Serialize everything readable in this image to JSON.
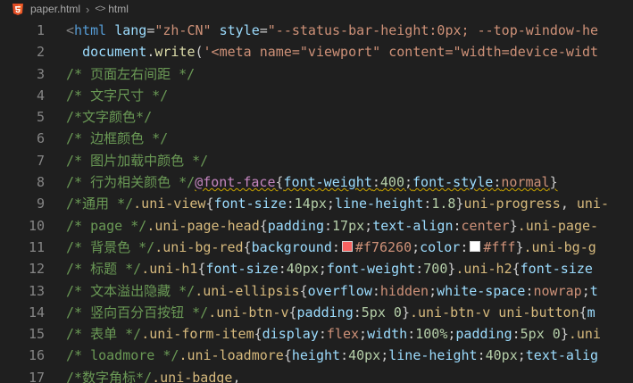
{
  "breadcrumb": {
    "file": "paper.html",
    "symbol": "html"
  },
  "colors": {
    "swatch_red": "#f76260",
    "swatch_white": "#ffffff"
  },
  "lines": [
    {
      "n": "1",
      "tokens": [
        {
          "c": "tag",
          "t": "<"
        },
        {
          "c": "tn",
          "t": "html"
        },
        {
          "c": "pl",
          "t": " "
        },
        {
          "c": "at",
          "t": "lang"
        },
        {
          "c": "pl",
          "t": "="
        },
        {
          "c": "st",
          "t": "\"zh-CN\""
        },
        {
          "c": "pl",
          "t": " "
        },
        {
          "c": "at",
          "t": "style"
        },
        {
          "c": "pl",
          "t": "="
        },
        {
          "c": "st",
          "t": "\"--status-bar-height:0px; --top-window-he"
        }
      ]
    },
    {
      "n": "2",
      "tokens": [
        {
          "c": "pl",
          "t": "  "
        },
        {
          "c": "at",
          "t": "document"
        },
        {
          "c": "pl",
          "t": "."
        },
        {
          "c": "fn",
          "t": "write"
        },
        {
          "c": "pl",
          "t": "("
        },
        {
          "c": "st",
          "t": "'<meta name=\"viewport\" content=\"width=device-widt"
        }
      ]
    },
    {
      "n": "3",
      "tokens": [
        {
          "c": "cm",
          "t": "/* 页面左右间距 */"
        }
      ]
    },
    {
      "n": "4",
      "tokens": [
        {
          "c": "cm",
          "t": "/* 文字尺寸 */"
        }
      ]
    },
    {
      "n": "5",
      "tokens": [
        {
          "c": "cm",
          "t": "/*文字颜色*/"
        }
      ]
    },
    {
      "n": "6",
      "tokens": [
        {
          "c": "cm",
          "t": "/* 边框颜色 */"
        }
      ]
    },
    {
      "n": "7",
      "tokens": [
        {
          "c": "cm",
          "t": "/* 图片加载中颜色 */"
        }
      ]
    },
    {
      "n": "8",
      "tokens": [
        {
          "c": "cm",
          "t": "/* 行为相关颜色 */"
        },
        {
          "c": "kw squig",
          "t": "@font-face"
        },
        {
          "c": "pl squig",
          "t": "{"
        },
        {
          "c": "pr squig",
          "t": "font-weight"
        },
        {
          "c": "pl squig",
          "t": ":"
        },
        {
          "c": "num squig",
          "t": "400"
        },
        {
          "c": "pl squig",
          "t": ";"
        },
        {
          "c": "pr squig",
          "t": "font-style"
        },
        {
          "c": "pl squig",
          "t": ":"
        },
        {
          "c": "val squig",
          "t": "normal"
        },
        {
          "c": "pl squig",
          "t": "}"
        }
      ]
    },
    {
      "n": "9",
      "tokens": [
        {
          "c": "cm",
          "t": "/*通用 */"
        },
        {
          "c": "sel",
          "t": ".uni-view"
        },
        {
          "c": "pl",
          "t": "{"
        },
        {
          "c": "pr",
          "t": "font-size"
        },
        {
          "c": "pl",
          "t": ":"
        },
        {
          "c": "num",
          "t": "14px"
        },
        {
          "c": "pl",
          "t": ";"
        },
        {
          "c": "pr",
          "t": "line-height"
        },
        {
          "c": "pl",
          "t": ":"
        },
        {
          "c": "num",
          "t": "1.8"
        },
        {
          "c": "pl",
          "t": "}"
        },
        {
          "c": "sel",
          "t": "uni-progress"
        },
        {
          "c": "pl",
          "t": ", "
        },
        {
          "c": "sel",
          "t": "uni-"
        }
      ]
    },
    {
      "n": "10",
      "tokens": [
        {
          "c": "cm",
          "t": "/* page */"
        },
        {
          "c": "sel",
          "t": ".uni-page-head"
        },
        {
          "c": "pl",
          "t": "{"
        },
        {
          "c": "pr",
          "t": "padding"
        },
        {
          "c": "pl",
          "t": ":"
        },
        {
          "c": "num",
          "t": "17px"
        },
        {
          "c": "pl",
          "t": ";"
        },
        {
          "c": "pr",
          "t": "text-align"
        },
        {
          "c": "pl",
          "t": ":"
        },
        {
          "c": "val",
          "t": "center"
        },
        {
          "c": "pl",
          "t": "}"
        },
        {
          "c": "sel",
          "t": ".uni-page-"
        }
      ]
    },
    {
      "n": "11",
      "tokens": [
        {
          "c": "cm",
          "t": "/* 背景色 */"
        },
        {
          "c": "sel",
          "t": ".uni-bg-red"
        },
        {
          "c": "pl",
          "t": "{"
        },
        {
          "c": "pr",
          "t": "background"
        },
        {
          "c": "pl",
          "t": ":"
        },
        {
          "c": "swatch",
          "k": "swatch_red"
        },
        {
          "c": "val",
          "t": "#f76260"
        },
        {
          "c": "pl",
          "t": ";"
        },
        {
          "c": "pr",
          "t": "color"
        },
        {
          "c": "pl",
          "t": ":"
        },
        {
          "c": "swatch",
          "k": "swatch_white"
        },
        {
          "c": "val",
          "t": "#fff"
        },
        {
          "c": "pl",
          "t": "}"
        },
        {
          "c": "sel",
          "t": ".uni-bg-g"
        }
      ]
    },
    {
      "n": "12",
      "tokens": [
        {
          "c": "cm",
          "t": "/* 标题 */"
        },
        {
          "c": "sel",
          "t": ".uni-h1"
        },
        {
          "c": "pl",
          "t": "{"
        },
        {
          "c": "pr",
          "t": "font-size"
        },
        {
          "c": "pl",
          "t": ":"
        },
        {
          "c": "num",
          "t": "40px"
        },
        {
          "c": "pl",
          "t": ";"
        },
        {
          "c": "pr",
          "t": "font-weight"
        },
        {
          "c": "pl",
          "t": ":"
        },
        {
          "c": "num",
          "t": "700"
        },
        {
          "c": "pl",
          "t": "}"
        },
        {
          "c": "sel",
          "t": ".uni-h2"
        },
        {
          "c": "pl",
          "t": "{"
        },
        {
          "c": "pr",
          "t": "font-size"
        }
      ]
    },
    {
      "n": "13",
      "tokens": [
        {
          "c": "cm",
          "t": "/* 文本溢出隐藏 */"
        },
        {
          "c": "sel",
          "t": ".uni-ellipsis"
        },
        {
          "c": "pl",
          "t": "{"
        },
        {
          "c": "pr",
          "t": "overflow"
        },
        {
          "c": "pl",
          "t": ":"
        },
        {
          "c": "val",
          "t": "hidden"
        },
        {
          "c": "pl",
          "t": ";"
        },
        {
          "c": "pr",
          "t": "white-space"
        },
        {
          "c": "pl",
          "t": ":"
        },
        {
          "c": "val",
          "t": "nowrap"
        },
        {
          "c": "pl",
          "t": ";"
        },
        {
          "c": "pr",
          "t": "t"
        }
      ]
    },
    {
      "n": "14",
      "tokens": [
        {
          "c": "cm",
          "t": "/* 竖向百分百按钮 */"
        },
        {
          "c": "sel",
          "t": ".uni-btn-v"
        },
        {
          "c": "pl",
          "t": "{"
        },
        {
          "c": "pr",
          "t": "padding"
        },
        {
          "c": "pl",
          "t": ":"
        },
        {
          "c": "num",
          "t": "5px 0"
        },
        {
          "c": "pl",
          "t": "}"
        },
        {
          "c": "sel",
          "t": ".uni-btn-v uni-button"
        },
        {
          "c": "pl",
          "t": "{"
        },
        {
          "c": "pr",
          "t": "m"
        }
      ]
    },
    {
      "n": "15",
      "tokens": [
        {
          "c": "cm",
          "t": "/* 表单 */"
        },
        {
          "c": "sel",
          "t": ".uni-form-item"
        },
        {
          "c": "pl",
          "t": "{"
        },
        {
          "c": "pr",
          "t": "display"
        },
        {
          "c": "pl",
          "t": ":"
        },
        {
          "c": "val",
          "t": "flex"
        },
        {
          "c": "pl",
          "t": ";"
        },
        {
          "c": "pr",
          "t": "width"
        },
        {
          "c": "pl",
          "t": ":"
        },
        {
          "c": "num",
          "t": "100%"
        },
        {
          "c": "pl",
          "t": ";"
        },
        {
          "c": "pr",
          "t": "padding"
        },
        {
          "c": "pl",
          "t": ":"
        },
        {
          "c": "num",
          "t": "5px 0"
        },
        {
          "c": "pl",
          "t": "}"
        },
        {
          "c": "sel",
          "t": ".uni"
        }
      ]
    },
    {
      "n": "16",
      "tokens": [
        {
          "c": "cm",
          "t": "/* loadmore */"
        },
        {
          "c": "sel",
          "t": ".uni-loadmore"
        },
        {
          "c": "pl",
          "t": "{"
        },
        {
          "c": "pr",
          "t": "height"
        },
        {
          "c": "pl",
          "t": ":"
        },
        {
          "c": "num",
          "t": "40px"
        },
        {
          "c": "pl",
          "t": ";"
        },
        {
          "c": "pr",
          "t": "line-height"
        },
        {
          "c": "pl",
          "t": ":"
        },
        {
          "c": "num",
          "t": "40px"
        },
        {
          "c": "pl",
          "t": ";"
        },
        {
          "c": "pr",
          "t": "text-alig"
        }
      ]
    },
    {
      "n": "17",
      "tokens": [
        {
          "c": "cm",
          "t": "/*数字角标*/"
        },
        {
          "c": "sel",
          "t": ".uni-badge"
        },
        {
          "c": "pl",
          "t": ","
        }
      ]
    }
  ]
}
